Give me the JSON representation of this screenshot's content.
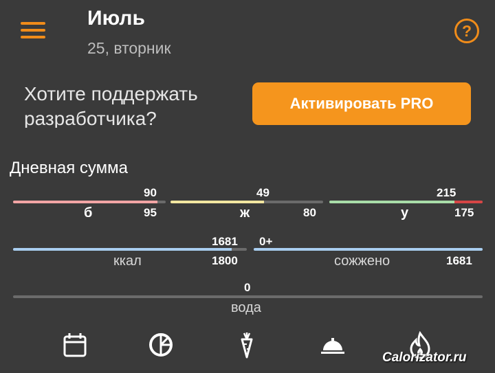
{
  "header": {
    "month": "Июль",
    "date": "25, вторник"
  },
  "promo": {
    "text": "Хотите поддержать разработчика?",
    "button_label": "Активировать PRO"
  },
  "daily": {
    "title": "Дневная сумма",
    "protein": {
      "label": "б",
      "current": "90",
      "goal": "95",
      "fraction": 0.947,
      "color": "#f2a5a5"
    },
    "fat": {
      "label": "ж",
      "current": "49",
      "goal": "80",
      "fraction": 0.6125,
      "color": "#f2e6a0"
    },
    "carbs": {
      "label": "у",
      "current": "215",
      "goal": "175",
      "fraction": 1.0,
      "over_fraction": 0.186,
      "color": "#a8dca8",
      "over_color": "#d64545"
    },
    "kcal": {
      "label": "ккал",
      "current": "1681",
      "goal": "1800",
      "fraction": 0.934,
      "color": "#a8cdef"
    },
    "burned": {
      "label": "сожжено",
      "current": "0+",
      "goal": "1681",
      "fraction": 1.0,
      "color": "#a8cdef"
    },
    "water": {
      "label": "вода",
      "current": "0",
      "fraction": 0.0,
      "color": "#a8cdef"
    }
  },
  "nav": [
    "calendar-icon",
    "pie-chart-icon",
    "carrot-icon",
    "cloche-icon",
    "flame-icon"
  ],
  "watermark": "Calorizator.ru",
  "colors": {
    "background": "#3a3a3a",
    "accent": "#f5951d"
  }
}
